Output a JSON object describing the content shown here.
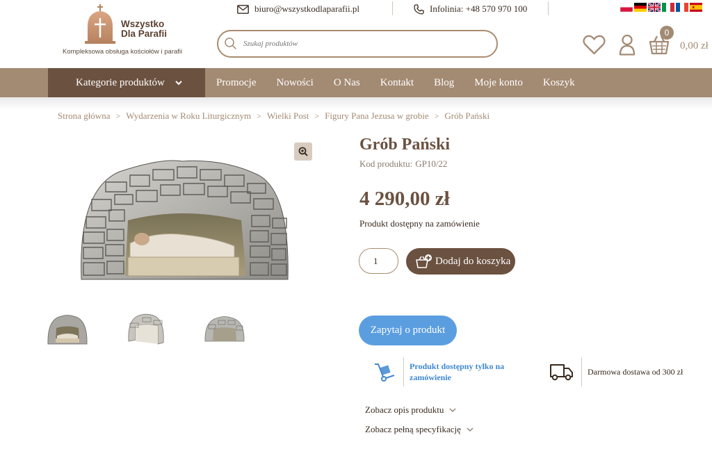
{
  "header": {
    "logo_line1": "Wszystko",
    "logo_line2": "Dla Parafii",
    "tagline": "Kompleksowa obsługa kościołów i parafii",
    "email": "biuro@wszystkodlaparafii.pl",
    "phone": "Infolinia: +48 570 970 100",
    "search_placeholder": "Szukaj produktów",
    "cart_count": "0",
    "cart_total": "0,00 zł",
    "languages": [
      "pl",
      "de",
      "en",
      "it",
      "fr",
      "es"
    ]
  },
  "nav": {
    "categories_label": "Kategorie produktów",
    "items": [
      "Promocje",
      "Nowości",
      "O Nas",
      "Kontakt",
      "Blog",
      "Moje konto",
      "Koszyk"
    ]
  },
  "breadcrumb": {
    "items": [
      "Strona główna",
      "Wydarzenia w Roku Liturgicznym",
      "Wielki Post",
      "Figury Pana Jezusa w grobie",
      "Grób Pański"
    ]
  },
  "product": {
    "title": "Grób Pański",
    "code_label": "Kod produktu:",
    "code": "GP10/22",
    "price": "4 290,00 zł",
    "availability": "Produkt dostępny na zamówienie",
    "quantity": "1",
    "add_to_cart": "Dodaj do koszyka",
    "ask": "Zapytaj o produkt",
    "order_only": "Produkt dostępny tylko na zamówienie",
    "free_delivery": "Darmowa dostawa od 300 zł",
    "show_description": "Zobacz opis produktu",
    "show_specification": "Zobacz pełną specyfikację"
  },
  "colors": {
    "brand": "#a38a73",
    "brand_dark": "#6b5140",
    "ask_blue": "#5b9ee0"
  }
}
